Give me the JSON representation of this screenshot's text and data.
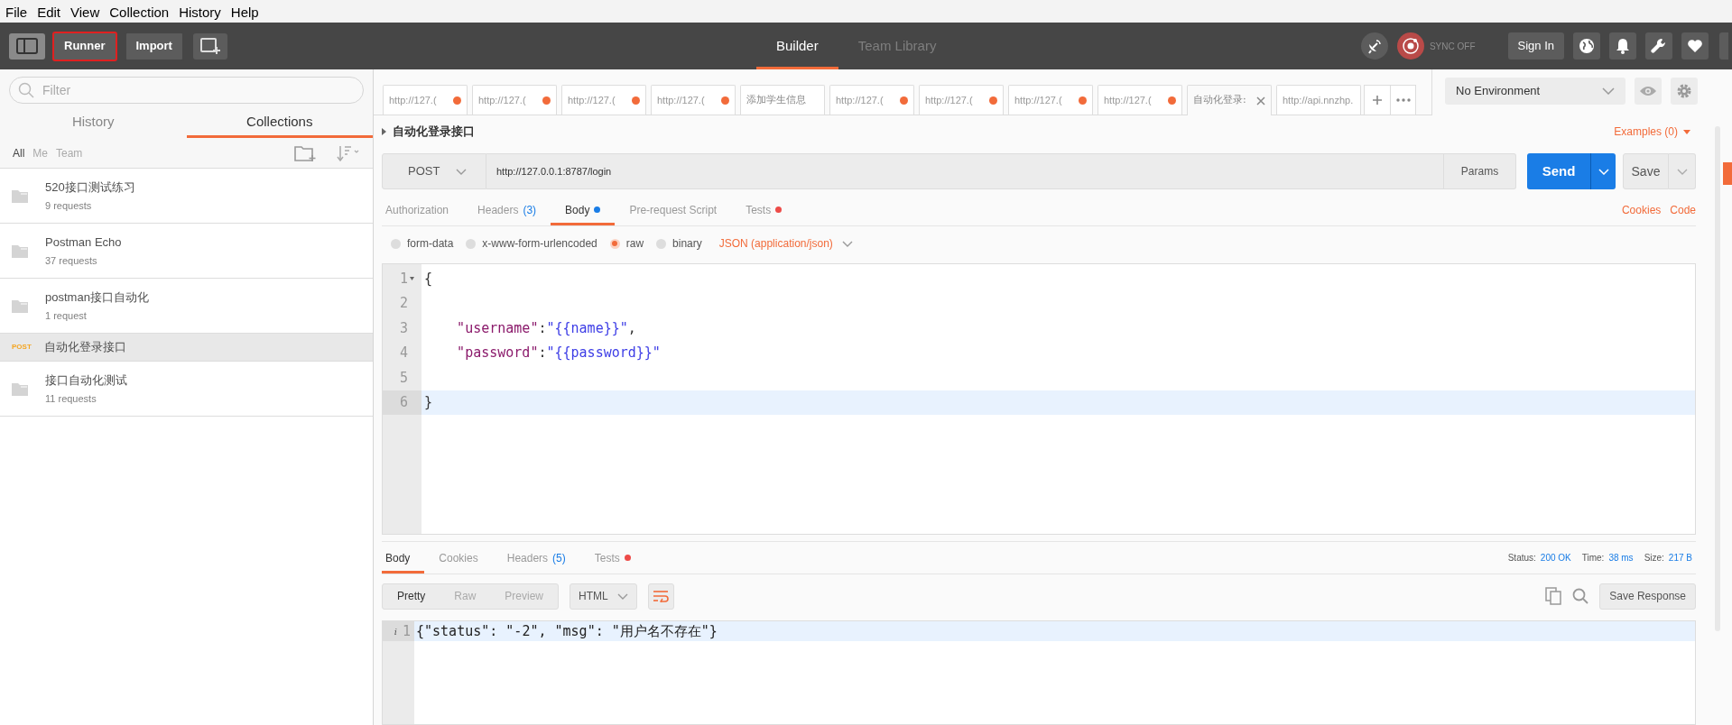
{
  "menu": [
    "File",
    "Edit",
    "View",
    "Collection",
    "History",
    "Help"
  ],
  "toolbar": {
    "buttons": [
      {
        "label": "Runner",
        "outlined": true
      },
      {
        "label": "Import",
        "outlined": false
      }
    ],
    "views": [
      {
        "label": "Builder",
        "selected": true
      },
      {
        "label": "Team Library",
        "selected": false
      }
    ],
    "sync": "SYNC OFF",
    "sign_in": "Sign In"
  },
  "sidebar": {
    "filter": {
      "placeholder": "Filter"
    },
    "tabs": [
      {
        "label": "History",
        "selected": false
      },
      {
        "label": "Collections",
        "selected": true
      }
    ],
    "scopes": [
      {
        "label": "All",
        "selected": true
      },
      {
        "label": "Me",
        "selected": false
      },
      {
        "label": "Team",
        "selected": false
      }
    ],
    "items": [
      {
        "kind": "folder",
        "name": "520接口测试练习",
        "count": "9 requests",
        "selected": false
      },
      {
        "kind": "folder",
        "name": "Postman Echo",
        "count": "37 requests",
        "selected": false
      },
      {
        "kind": "folder",
        "name": "postman接口自动化",
        "count": "1 request",
        "selected": false
      },
      {
        "kind": "request",
        "method": "POST",
        "name": "自动化登录接口",
        "selected": true
      },
      {
        "kind": "folder",
        "name": "接口自动化测试",
        "count": "11 requests",
        "selected": false
      }
    ]
  },
  "request_tabs": [
    {
      "label": "http://127.(",
      "unsaved": true,
      "selected": false
    },
    {
      "label": "http://127.(",
      "unsaved": true,
      "selected": false
    },
    {
      "label": "http://127.(",
      "unsaved": true,
      "selected": false
    },
    {
      "label": "http://127.(",
      "unsaved": true,
      "selected": false
    },
    {
      "label": "添加学生信息",
      "unsaved": false,
      "selected": false
    },
    {
      "label": "http://127.(",
      "unsaved": true,
      "selected": false
    },
    {
      "label": "http://127.(",
      "unsaved": true,
      "selected": false
    },
    {
      "label": "http://127.(",
      "unsaved": true,
      "selected": false
    },
    {
      "label": "http://127.(",
      "unsaved": true,
      "selected": false
    },
    {
      "label": "自动化登录:",
      "unsaved": false,
      "selected": true
    },
    {
      "label": "http://api.nnzhp.",
      "unsaved": false,
      "selected": false
    }
  ],
  "environment": "No Environment",
  "request": {
    "name": "自动化登录接口",
    "examples": "Examples (0)",
    "method": "POST",
    "url": "http://127.0.0.1:8787/login",
    "params": "Params",
    "send": "Send",
    "save": "Save",
    "tabs": [
      {
        "label": "Authorization",
        "selected": false
      },
      {
        "label": "Headers",
        "count": "(3)",
        "selected": false
      },
      {
        "label": "Body",
        "color": "#1a7de6",
        "selected": true
      },
      {
        "label": "Pre-request Script",
        "selected": false
      },
      {
        "label": "Tests",
        "color": "#ed4b48",
        "selected": false
      }
    ],
    "links": [
      "Cookies",
      "Code"
    ],
    "body_types": [
      {
        "label": "form-data",
        "selected": false
      },
      {
        "label": "x-www-form-urlencoded",
        "selected": false
      },
      {
        "label": "raw",
        "selected": true
      },
      {
        "label": "binary",
        "selected": false
      }
    ],
    "content_type": "JSON (application/json)",
    "lines": [
      {
        "number": "1",
        "foldable": true,
        "active": false,
        "parts": [
          {
            "kind": "punct",
            "text": "{"
          }
        ]
      },
      {
        "number": "2",
        "foldable": false,
        "active": false
      },
      {
        "number": "3",
        "foldable": false,
        "active": false,
        "parts": [
          {
            "kind": "key",
            "text": "    \"username\""
          },
          {
            "kind": "punct",
            "text": ":"
          },
          {
            "kind": "string",
            "text": "\"{{name}}\""
          },
          {
            "kind": "punct",
            "text": ","
          }
        ]
      },
      {
        "number": "4",
        "foldable": false,
        "active": false,
        "parts": [
          {
            "kind": "key",
            "text": "    \"password\""
          },
          {
            "kind": "punct",
            "text": ":"
          },
          {
            "kind": "string",
            "text": "\"{{password}}\""
          }
        ]
      },
      {
        "number": "5",
        "foldable": false,
        "active": false
      },
      {
        "number": "6",
        "foldable": false,
        "active": true,
        "parts": [
          {
            "kind": "punct",
            "text": "}"
          }
        ]
      }
    ]
  },
  "response": {
    "tabs": [
      {
        "label": "Body",
        "selected": true
      },
      {
        "label": "Cookies",
        "selected": false
      },
      {
        "label": "Headers",
        "count": "(5)",
        "selected": false
      },
      {
        "label": "Tests",
        "color": "#ed4b48",
        "selected": false
      }
    ],
    "stats": [
      {
        "label": "Status:",
        "value": "200 OK"
      },
      {
        "label": "Time:",
        "value": "38 ms"
      },
      {
        "label": "Size:",
        "value": "217 B"
      }
    ],
    "views": [
      {
        "label": "Pretty",
        "selected": true
      },
      {
        "label": "Raw",
        "selected": false
      },
      {
        "label": "Preview",
        "selected": false
      }
    ],
    "format": "HTML",
    "save": "Save Response",
    "lines": [
      {
        "number": "1",
        "marker": "i",
        "text": "{\"status\": \"-2\", \"msg\": \"用户名不存在\"}"
      }
    ]
  }
}
